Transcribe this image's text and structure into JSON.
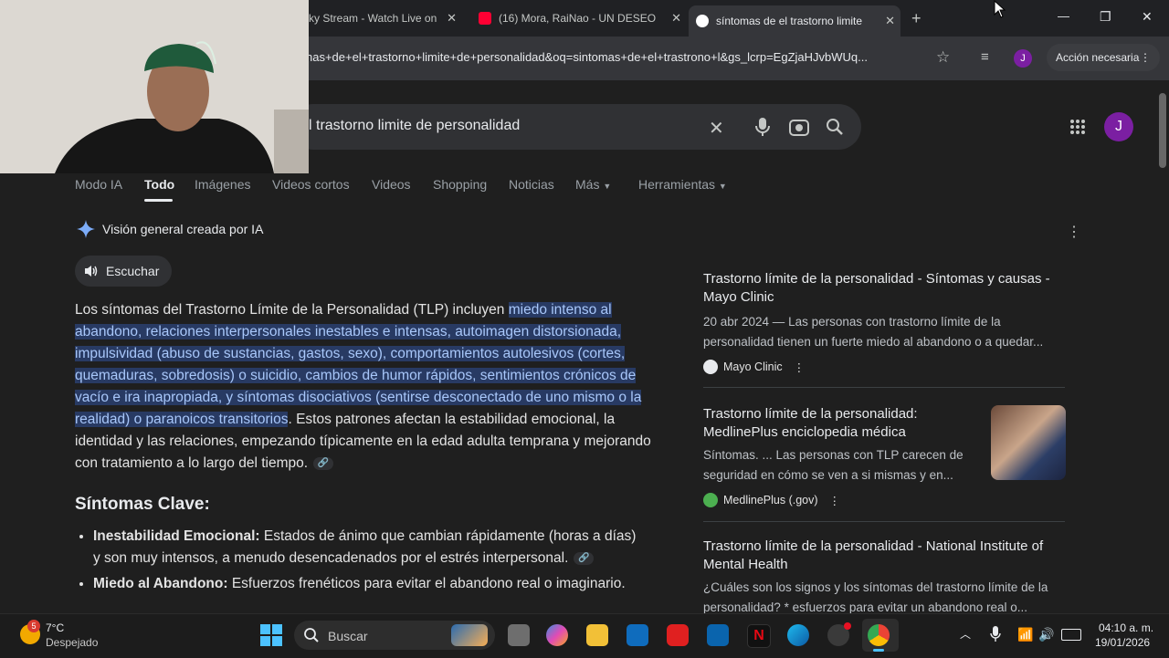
{
  "browser": {
    "tabs": [
      {
        "title": "ky Stream - Watch Live on"
      },
      {
        "title": "(16) Mora, RaiNao - UN DESEO"
      },
      {
        "title": "síntomas de el trastorno limite"
      }
    ],
    "new_tab": "+",
    "url": "nas+de+el+trastorno+limite+de+personalidad&oq=sintomas+de+el+trastrono+l&gs_lcrp=EgZjaHJvbWUq...",
    "profile_initial": "J",
    "accion": "Acción necesaria",
    "window_min": "—",
    "window_max": "❐",
    "window_close": "✕"
  },
  "search": {
    "query": "l trastorno limite de personalidad",
    "profile_initial": "J"
  },
  "nav": [
    "Modo IA",
    "Todo",
    "Imágenes",
    "Videos cortos",
    "Videos",
    "Shopping",
    "Noticias",
    "Más",
    "Herramientas"
  ],
  "ai": {
    "title": "Visión general creada por IA",
    "listen": "Escuchar",
    "para_start": "Los síntomas del Trastorno Límite de la Personalidad (TLP) incluyen ",
    "para_highlight": "miedo intenso al abandono, relaciones interpersonales inestables e intensas, autoimagen distorsionada, impulsividad (abuso de sustancias, gastos, sexo), comportamientos autolesivos (cortes, quemaduras, sobredosis) o suicidio, cambios de humor rápidos, sentimientos crónicos de vacío e ira inapropiada, y síntomas disociativos (sentirse desconectado de uno mismo o la realidad) o paranoicos transitorios",
    "para_end": ". Estos patrones afectan la estabilidad emocional, la identidad y las relaciones, empezando típicamente en la edad adulta temprana y mejorando con tratamiento a lo largo del tiempo.",
    "heading": "Síntomas Clave:",
    "bullets": [
      {
        "label": "Inestabilidad Emocional:",
        "text": " Estados de ánimo que cambian rápidamente (horas a días) y son muy intensos, a menudo desencadenados por el estrés interpersonal."
      },
      {
        "label": "Miedo al Abandono:",
        "text": " Esfuerzos frenéticos para evitar el abandono real o imaginario."
      }
    ]
  },
  "cards": [
    {
      "title": "Trastorno límite de la personalidad - Síntomas y causas - Mayo Clinic",
      "snippet": "20 abr 2024 — Las personas con trastorno límite de la personalidad tienen un fuerte miedo al abandono o a quedar...",
      "source": "Mayo Clinic"
    },
    {
      "title": "Trastorno límite de la personalidad: MedlinePlus enciclopedia médica",
      "snippet": "Síntomas. ... Las personas con TLP carecen de seguridad en cómo se ven a si mismas y en...",
      "source": "MedlinePlus (.gov)"
    },
    {
      "title": "Trastorno límite de la personalidad - National Institute of Mental Health",
      "snippet": "¿Cuáles son los signos y los síntomas del trastorno límite de la personalidad? * esfuerzos para evitar un abandono real o..."
    }
  ],
  "taskbar": {
    "weather_temp": "7°C",
    "weather_desc": "Despejado",
    "weather_badge": "5",
    "search": "Buscar",
    "time": "04:10 a. m.",
    "date": "19/01/2026"
  }
}
